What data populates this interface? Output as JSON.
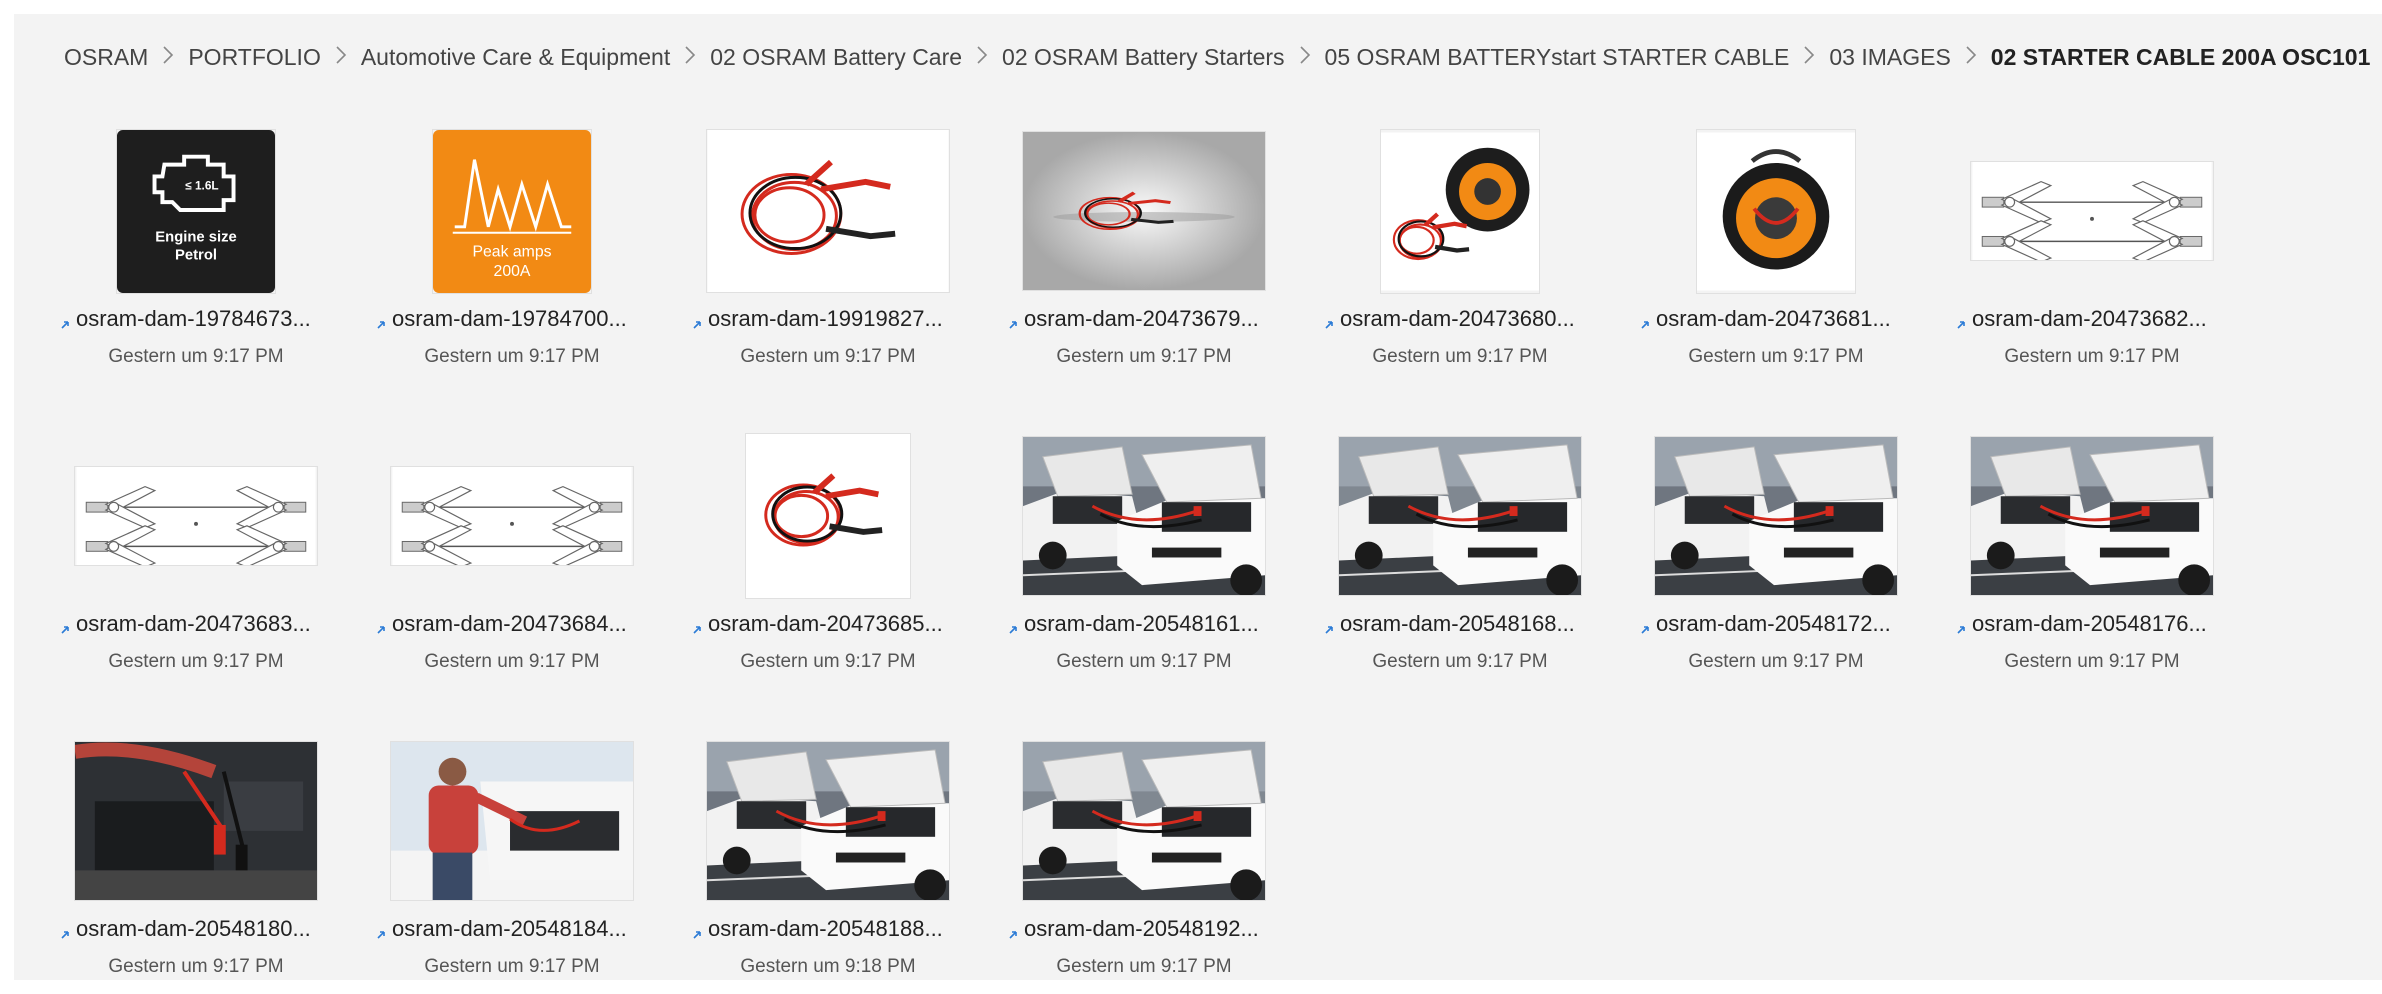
{
  "breadcrumb": [
    "OSRAM",
    "PORTFOLIO",
    "Automotive Care & Equipment",
    "02 OSRAM Battery Care",
    "02 OSRAM Battery Starters",
    "05 OSRAM BATTERYstart STARTER CABLE",
    "03 IMAGES",
    "02 STARTER CABLE 200A OSC101"
  ],
  "separator_icon": "chevron-right-icon",
  "sync_icon": "sync-pending-icon",
  "files": [
    {
      "name": "osram-dam-19784673...",
      "date": "Gestern um 9:17 PM",
      "thumb": "engine",
      "thumb_text": [
        "≤ 1.6L",
        "Engine size",
        "Petrol"
      ]
    },
    {
      "name": "osram-dam-19784700...",
      "date": "Gestern um 9:17 PM",
      "thumb": "peak",
      "thumb_text": [
        "Peak amps",
        "200A"
      ]
    },
    {
      "name": "osram-dam-19919827...",
      "date": "Gestern um 9:17 PM",
      "thumb": "cable-wide"
    },
    {
      "name": "osram-dam-20473679...",
      "date": "Gestern um 9:17 PM",
      "thumb": "cable-grey"
    },
    {
      "name": "osram-dam-20473680...",
      "date": "Gestern um 9:17 PM",
      "thumb": "cable-bag"
    },
    {
      "name": "osram-dam-20473681...",
      "date": "Gestern um 9:17 PM",
      "thumb": "bag"
    },
    {
      "name": "osram-dam-20473682...",
      "date": "Gestern um 9:17 PM",
      "thumb": "drawing"
    },
    {
      "name": "osram-dam-20473683...",
      "date": "Gestern um 9:17 PM",
      "thumb": "drawing"
    },
    {
      "name": "osram-dam-20473684...",
      "date": "Gestern um 9:17 PM",
      "thumb": "drawing"
    },
    {
      "name": "osram-dam-20473685...",
      "date": "Gestern um 9:17 PM",
      "thumb": "cable-square"
    },
    {
      "name": "osram-dam-20548161...",
      "date": "Gestern um 9:17 PM",
      "thumb": "cars"
    },
    {
      "name": "osram-dam-20548168...",
      "date": "Gestern um 9:17 PM",
      "thumb": "cars"
    },
    {
      "name": "osram-dam-20548172...",
      "date": "Gestern um 9:17 PM",
      "thumb": "cars"
    },
    {
      "name": "osram-dam-20548176...",
      "date": "Gestern um 9:17 PM",
      "thumb": "cars"
    },
    {
      "name": "osram-dam-20548180...",
      "date": "Gestern um 9:17 PM",
      "thumb": "engine-bay"
    },
    {
      "name": "osram-dam-20548184...",
      "date": "Gestern um 9:17 PM",
      "thumb": "man"
    },
    {
      "name": "osram-dam-20548188...",
      "date": "Gestern um 9:18 PM",
      "thumb": "cars"
    },
    {
      "name": "osram-dam-20548192...",
      "date": "Gestern um 9:17 PM",
      "thumb": "cars"
    }
  ],
  "colors": {
    "background": "#f3f3f3",
    "brand_orange": "#f28a14",
    "cable_red": "#d42a1e",
    "sync_blue": "#2b7bd6"
  }
}
